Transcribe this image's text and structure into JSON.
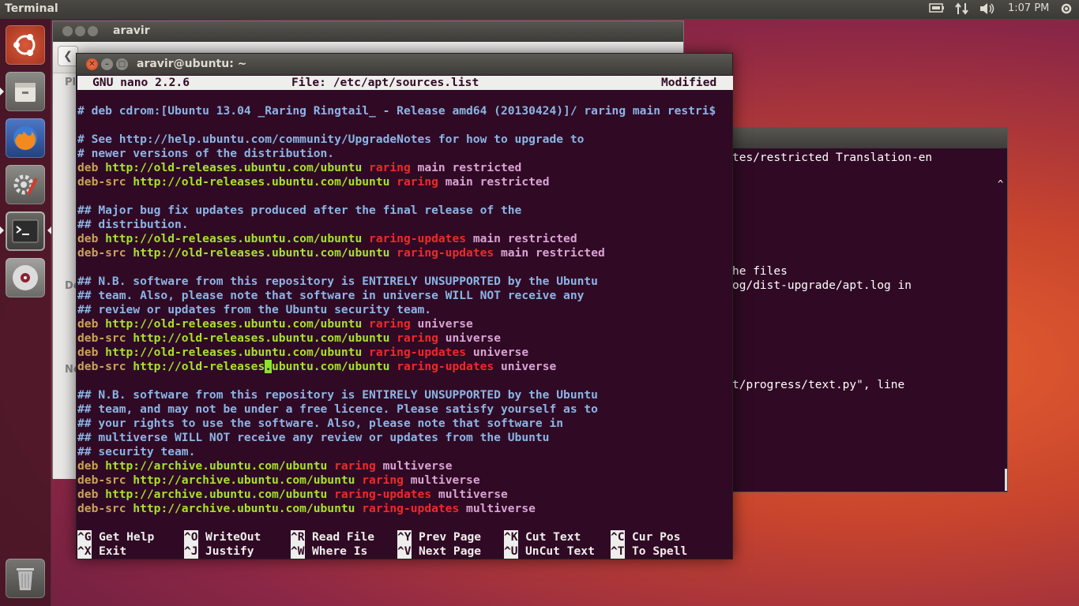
{
  "top_panel": {
    "app_title": "Terminal",
    "clock": "1:07 PM",
    "battery_icon": "battery-icon",
    "network_icon": "network-icon",
    "volume_icon": "volume-icon",
    "gear_icon": "system-gear-icon"
  },
  "launcher": {
    "items": [
      "ubuntu-dash",
      "files",
      "firefox",
      "system-settings",
      "terminal",
      "dvd",
      "trash"
    ]
  },
  "nautilus": {
    "title": "aravir",
    "side_labels": [
      "Pl",
      "De",
      "Ne"
    ]
  },
  "bg_terminal": {
    "lines": [
      "tes/restricted Translation-en",
      "^",
      "he files",
      "og/dist-upgrade/apt.log in",
      "t/progress/text.py\", line"
    ]
  },
  "terminal": {
    "title": "aravir@ubuntu: ~",
    "nano": {
      "version": "GNU nano 2.2.6",
      "file": "File: /etc/apt/sources.list",
      "status": "Modified"
    },
    "lines": [
      [
        {
          "t": "# deb cdrom:[Ubuntu 13.04 _Raring Ringtail_ - Release amd64 (20130424)]/ raring main restri$",
          "c": "c-comment"
        }
      ],
      [],
      [
        {
          "t": "# See http://help.ubuntu.com/community/UpgradeNotes for how to upgrade to",
          "c": "c-comment"
        }
      ],
      [
        {
          "t": "# newer versions of the distribution.",
          "c": "c-comment"
        }
      ],
      [
        {
          "t": "deb ",
          "c": "c-deb"
        },
        {
          "t": "http://old-releases.ubuntu.com/ubuntu ",
          "c": "c-url"
        },
        {
          "t": "raring ",
          "c": "c-dist"
        },
        {
          "t": "main restricted",
          "c": "c-comp"
        }
      ],
      [
        {
          "t": "deb-src ",
          "c": "c-deb"
        },
        {
          "t": "http://old-releases.ubuntu.com/ubuntu ",
          "c": "c-url"
        },
        {
          "t": "raring ",
          "c": "c-dist"
        },
        {
          "t": "main restricted",
          "c": "c-comp"
        }
      ],
      [],
      [
        {
          "t": "## Major bug fix updates produced after the final release of the",
          "c": "c-comment"
        }
      ],
      [
        {
          "t": "## distribution.",
          "c": "c-comment"
        }
      ],
      [
        {
          "t": "deb ",
          "c": "c-deb"
        },
        {
          "t": "http://old-releases.ubuntu.com/ubuntu ",
          "c": "c-url"
        },
        {
          "t": "raring-updates ",
          "c": "c-dist"
        },
        {
          "t": "main restricted",
          "c": "c-comp"
        }
      ],
      [
        {
          "t": "deb-src ",
          "c": "c-deb"
        },
        {
          "t": "http://old-releases.ubuntu.com/ubuntu ",
          "c": "c-url"
        },
        {
          "t": "raring-updates ",
          "c": "c-dist"
        },
        {
          "t": "main restricted",
          "c": "c-comp"
        }
      ],
      [],
      [
        {
          "t": "## N.B. software from this repository is ENTIRELY UNSUPPORTED by the Ubuntu",
          "c": "c-comment"
        }
      ],
      [
        {
          "t": "## team. Also, please note that software in universe WILL NOT receive any",
          "c": "c-comment"
        }
      ],
      [
        {
          "t": "## review or updates from the Ubuntu security team.",
          "c": "c-comment"
        }
      ],
      [
        {
          "t": "deb ",
          "c": "c-deb"
        },
        {
          "t": "http://old-releases.ubuntu.com/ubuntu ",
          "c": "c-url"
        },
        {
          "t": "raring ",
          "c": "c-dist"
        },
        {
          "t": "universe",
          "c": "c-comp"
        }
      ],
      [
        {
          "t": "deb-src ",
          "c": "c-deb"
        },
        {
          "t": "http://old-releases.ubuntu.com/ubuntu ",
          "c": "c-url"
        },
        {
          "t": "raring ",
          "c": "c-dist"
        },
        {
          "t": "universe",
          "c": "c-comp"
        }
      ],
      [
        {
          "t": "deb ",
          "c": "c-deb"
        },
        {
          "t": "http://old-releases.ubuntu.com/ubuntu ",
          "c": "c-url"
        },
        {
          "t": "raring-updates ",
          "c": "c-dist"
        },
        {
          "t": "universe",
          "c": "c-comp"
        }
      ],
      [
        {
          "t": "deb-src ",
          "c": "c-deb"
        },
        {
          "t": "http://old-releases",
          "c": "c-url"
        },
        {
          "t": ".",
          "c": "c-cursor"
        },
        {
          "t": "ubuntu.com/ubuntu ",
          "c": "c-url"
        },
        {
          "t": "raring-updates ",
          "c": "c-dist"
        },
        {
          "t": "universe",
          "c": "c-comp"
        }
      ],
      [],
      [
        {
          "t": "## N.B. software from this repository is ENTIRELY UNSUPPORTED by the Ubuntu",
          "c": "c-comment"
        }
      ],
      [
        {
          "t": "## team, and may not be under a free licence. Please satisfy yourself as to",
          "c": "c-comment"
        }
      ],
      [
        {
          "t": "## your rights to use the software. Also, please note that software in",
          "c": "c-comment"
        }
      ],
      [
        {
          "t": "## multiverse WILL NOT receive any review or updates from the Ubuntu",
          "c": "c-comment"
        }
      ],
      [
        {
          "t": "## security team.",
          "c": "c-comment"
        }
      ],
      [
        {
          "t": "deb ",
          "c": "c-deb"
        },
        {
          "t": "http://archive.ubuntu.com/ubuntu ",
          "c": "c-url"
        },
        {
          "t": "raring ",
          "c": "c-dist"
        },
        {
          "t": "multiverse",
          "c": "c-comp"
        }
      ],
      [
        {
          "t": "deb-src ",
          "c": "c-deb"
        },
        {
          "t": "http://archive.ubuntu.com/ubuntu ",
          "c": "c-url"
        },
        {
          "t": "raring ",
          "c": "c-dist"
        },
        {
          "t": "multiverse",
          "c": "c-comp"
        }
      ],
      [
        {
          "t": "deb ",
          "c": "c-deb"
        },
        {
          "t": "http://archive.ubuntu.com/ubuntu ",
          "c": "c-url"
        },
        {
          "t": "raring-updates ",
          "c": "c-dist"
        },
        {
          "t": "multiverse",
          "c": "c-comp"
        }
      ],
      [
        {
          "t": "deb-src ",
          "c": "c-deb"
        },
        {
          "t": "http://archive.ubuntu.com/ubuntu ",
          "c": "c-url"
        },
        {
          "t": "raring-updates ",
          "c": "c-dist"
        },
        {
          "t": "multiverse",
          "c": "c-comp"
        }
      ]
    ],
    "shortcuts": [
      [
        {
          "key": "^G",
          "label": "Get Help"
        },
        {
          "key": "^O",
          "label": "WriteOut"
        },
        {
          "key": "^R",
          "label": "Read File"
        },
        {
          "key": "^Y",
          "label": "Prev Page"
        },
        {
          "key": "^K",
          "label": "Cut Text"
        },
        {
          "key": "^C",
          "label": "Cur Pos"
        }
      ],
      [
        {
          "key": "^X",
          "label": "Exit"
        },
        {
          "key": "^J",
          "label": "Justify"
        },
        {
          "key": "^W",
          "label": "Where Is"
        },
        {
          "key": "^V",
          "label": "Next Page"
        },
        {
          "key": "^U",
          "label": "UnCut Text"
        },
        {
          "key": "^T",
          "label": "To Spell"
        }
      ]
    ]
  },
  "colors": {
    "terminal_bg": "#300a24",
    "comment": "#8ab5e6",
    "keyword": "#c9a25a",
    "url": "#a6e22e",
    "dist": "#ef2929",
    "component": "#d9a3d3"
  }
}
